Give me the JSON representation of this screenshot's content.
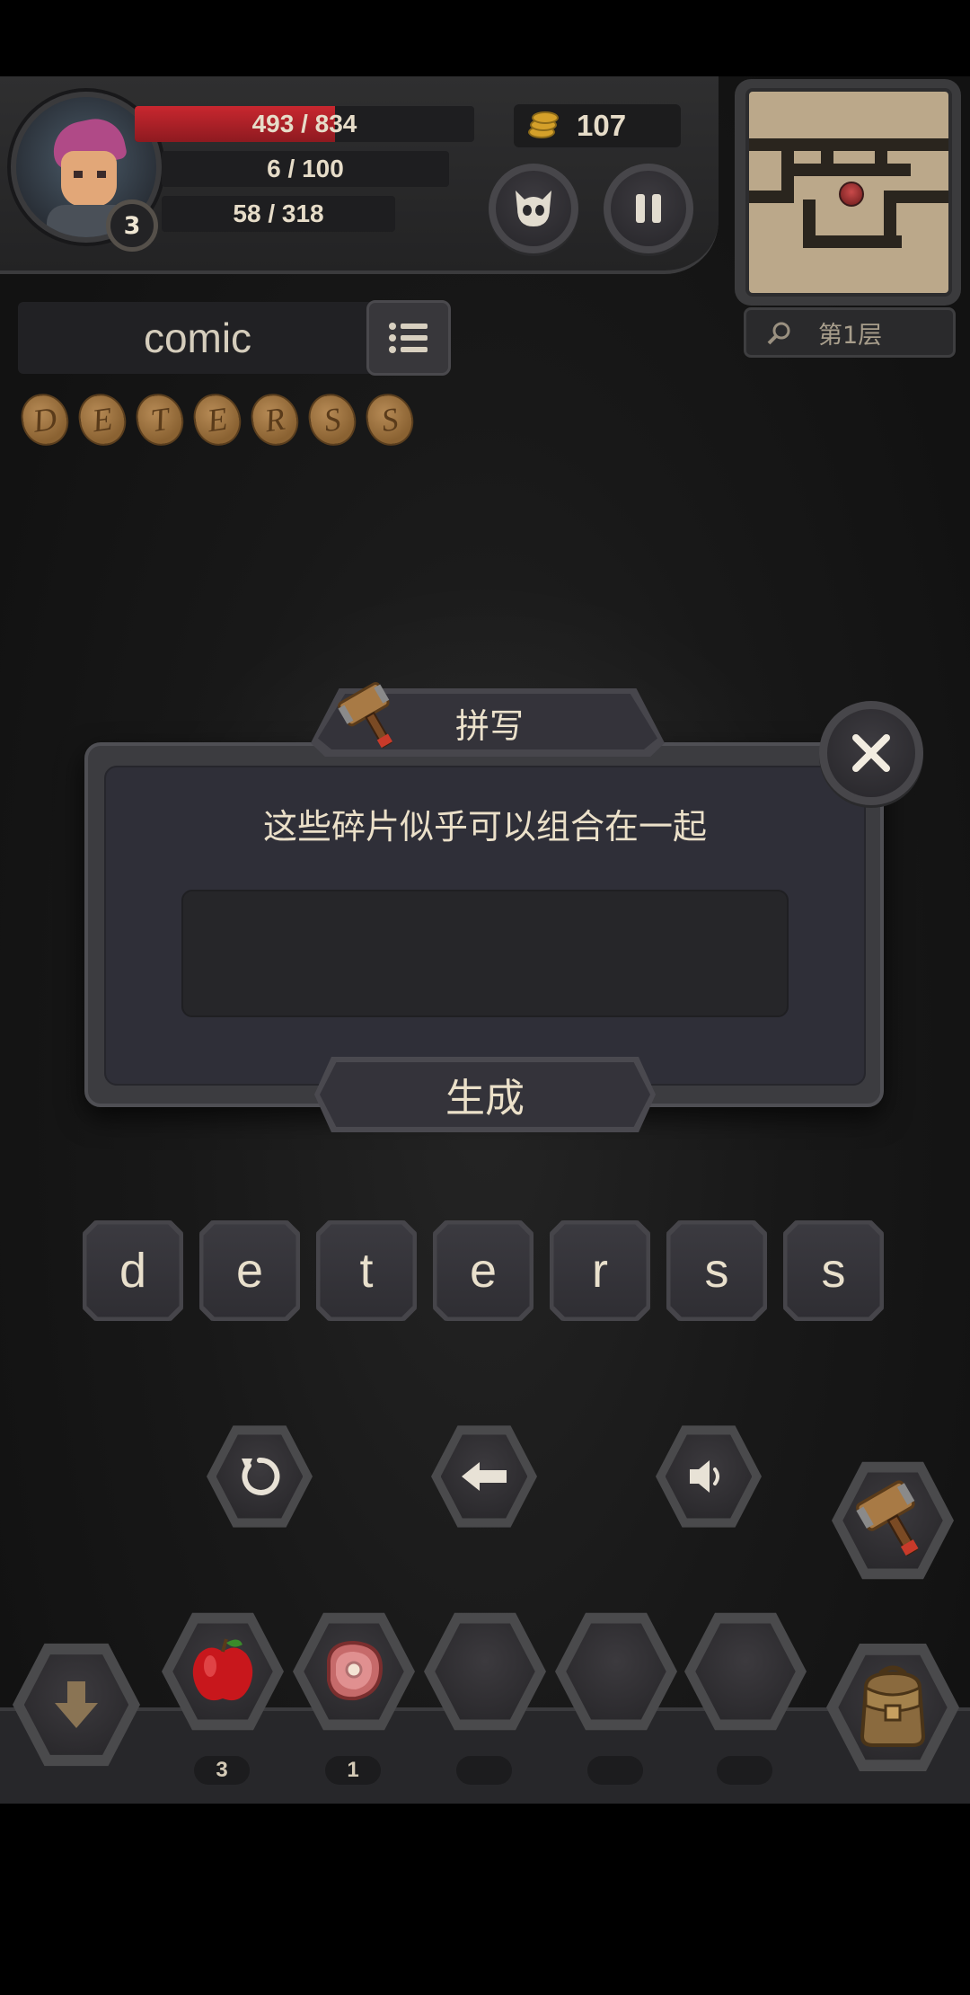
{
  "hud": {
    "level": "3",
    "hp_text": "493 / 834",
    "hp_fraction": 0.591,
    "mp_text": "6 / 100",
    "xp_text": "58 / 318",
    "gold": "107",
    "monster_icon": "monster-face-icon",
    "pause_icon": "pause-icon"
  },
  "minimap": {
    "floor_label": "第1层",
    "search_icon": "search-icon"
  },
  "word_hint": {
    "word": "comic",
    "list_icon": "list-icon",
    "fragments": [
      "D",
      "E",
      "T",
      "E",
      "R",
      "S",
      "S"
    ]
  },
  "dialog": {
    "title": "拼写",
    "message": "这些碎片似乎可以组合在一起",
    "input_value": "",
    "generate_label": "生成",
    "close_icon": "close-icon",
    "title_icon": "hammer-icon"
  },
  "letters": [
    "d",
    "e",
    "t",
    "e",
    "r",
    "s",
    "s"
  ],
  "controls": {
    "undo_icon": "undo-icon",
    "backspace_icon": "backspace-arrow-icon",
    "sound_icon": "speaker-icon",
    "forge_icon": "hammer-icon"
  },
  "inventory": {
    "down_icon": "down-arrow-icon",
    "bag_icon": "backpack-icon",
    "slots": [
      {
        "item": "apple-icon",
        "count": "3"
      },
      {
        "item": "meat-icon",
        "count": "1"
      },
      {
        "item": "",
        "count": ""
      },
      {
        "item": "",
        "count": ""
      },
      {
        "item": "",
        "count": ""
      }
    ]
  },
  "colors": {
    "hp": "#c8272f",
    "accent_text": "#ebe0c9",
    "panel": "#2f2f38",
    "token": "#a57a45"
  }
}
